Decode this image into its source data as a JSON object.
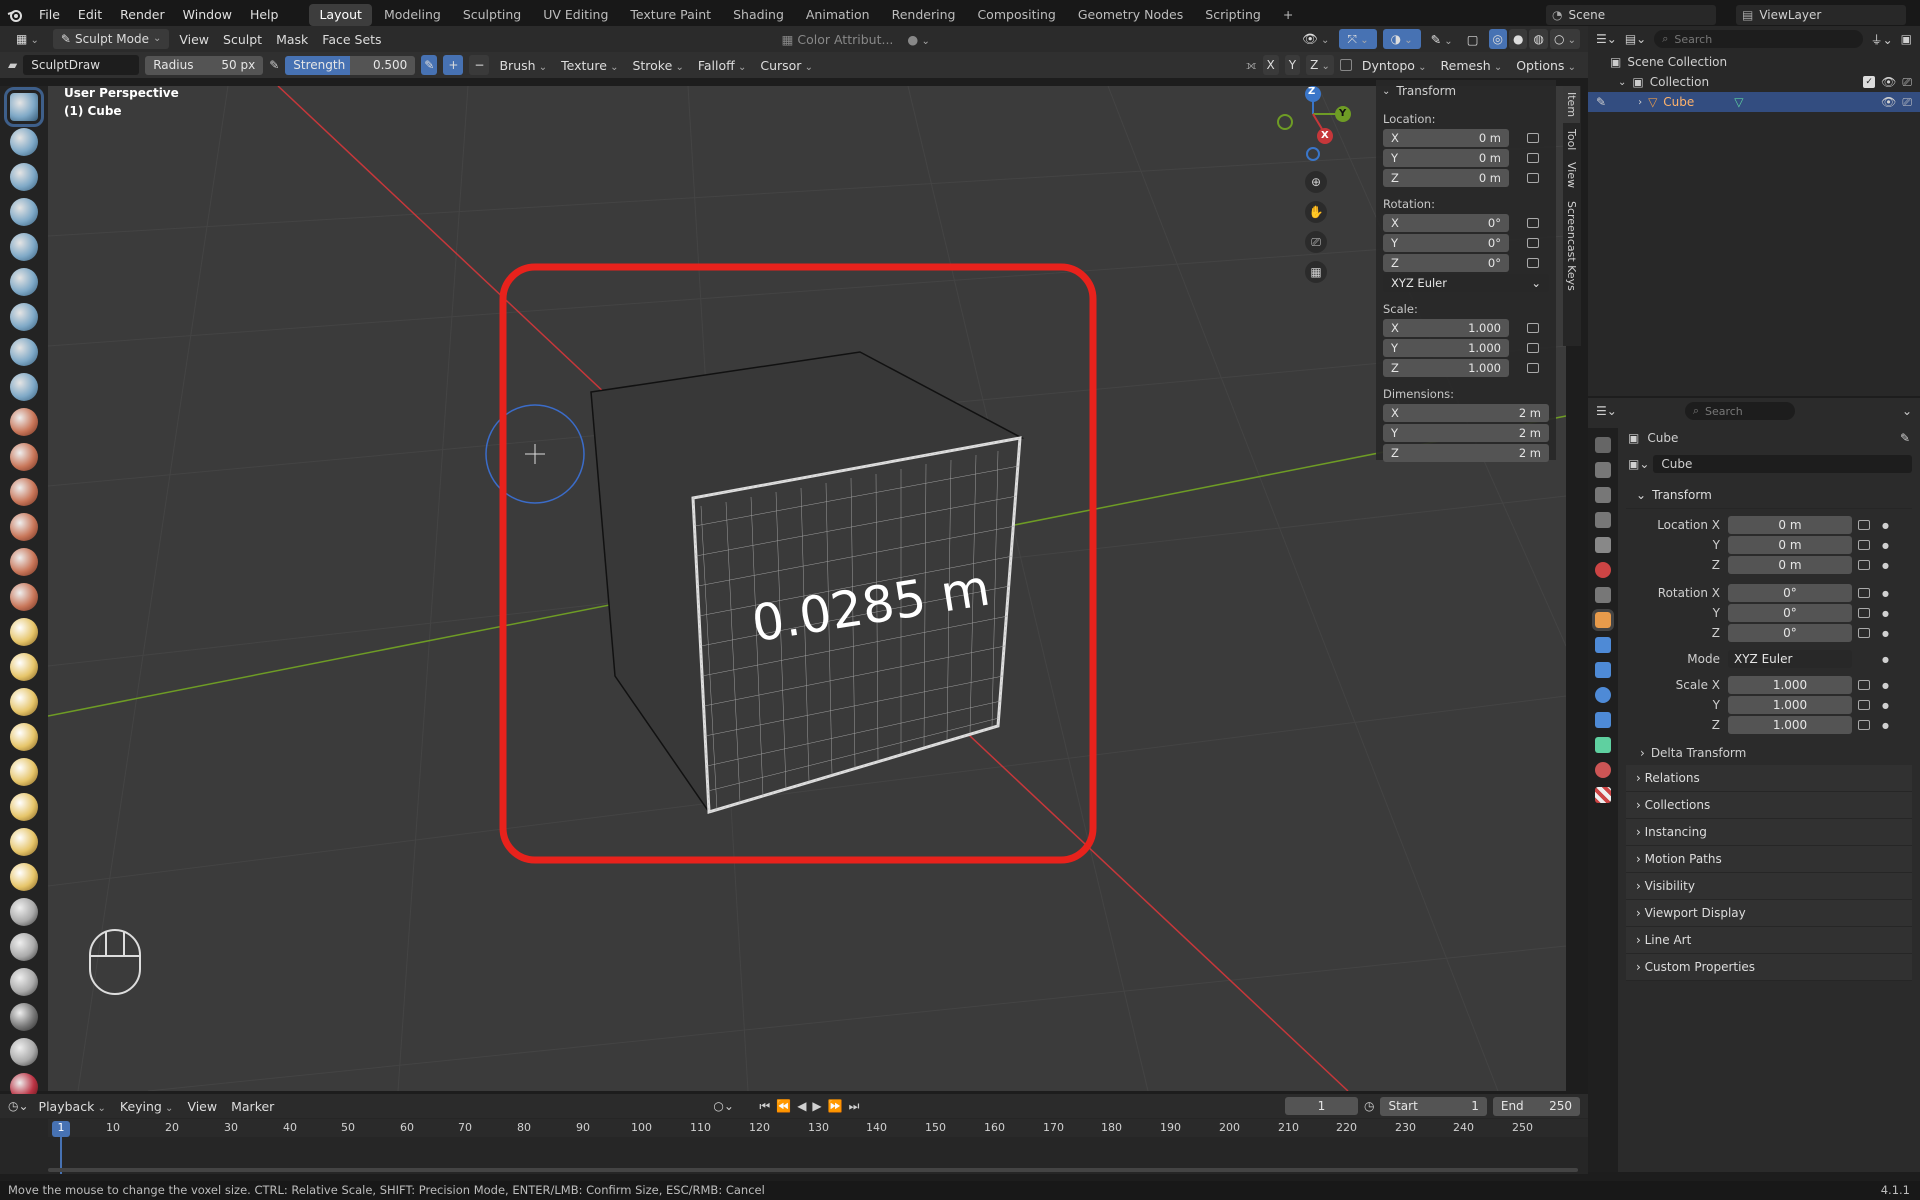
{
  "topbar": {
    "menus": [
      "File",
      "Edit",
      "Render",
      "Window",
      "Help"
    ],
    "workspaces": [
      "Layout",
      "Modeling",
      "Sculpting",
      "UV Editing",
      "Texture Paint",
      "Shading",
      "Animation",
      "Rendering",
      "Compositing",
      "Geometry Nodes",
      "Scripting"
    ],
    "active_workspace": "Layout",
    "scene": "Scene",
    "view_layer": "ViewLayer"
  },
  "viewport_header": {
    "mode": "Sculpt Mode",
    "menus": [
      "View",
      "Sculpt",
      "Mask",
      "Face Sets"
    ],
    "color_attr": "Color Attribut...",
    "axes": [
      "X",
      "Y",
      "Z"
    ]
  },
  "tool_header": {
    "brush_name": "SculptDraw",
    "radius_label": "Radius",
    "radius_value": "50 px",
    "strength_label": "Strength",
    "strength_value": "0.500",
    "plus": "+",
    "minus": "−",
    "menus": [
      "Brush",
      "Texture",
      "Stroke",
      "Falloff",
      "Cursor"
    ],
    "dyntopo": "Dyntopo",
    "remesh": "Remesh",
    "options": "Options"
  },
  "viewport": {
    "view_name": "User Perspective",
    "object_name": "(1) Cube",
    "voxel_size": "0.0285 m",
    "gizmo": {
      "x": "X",
      "y": "Y",
      "z": "Z"
    }
  },
  "n_panel": {
    "title": "Transform",
    "location_label": "Location:",
    "rotation_label": "Rotation:",
    "scale_label": "Scale:",
    "dimensions_label": "Dimensions:",
    "location": [
      {
        "axis": "X",
        "value": "0 m"
      },
      {
        "axis": "Y",
        "value": "0 m"
      },
      {
        "axis": "Z",
        "value": "0 m"
      }
    ],
    "rotation": [
      {
        "axis": "X",
        "value": "0°"
      },
      {
        "axis": "Y",
        "value": "0°"
      },
      {
        "axis": "Z",
        "value": "0°"
      }
    ],
    "rotation_mode": "XYZ Euler",
    "scale": [
      {
        "axis": "X",
        "value": "1.000"
      },
      {
        "axis": "Y",
        "value": "1.000"
      },
      {
        "axis": "Z",
        "value": "1.000"
      }
    ],
    "dimensions": [
      {
        "axis": "X",
        "value": "2 m"
      },
      {
        "axis": "Y",
        "value": "2 m"
      },
      {
        "axis": "Z",
        "value": "2 m"
      }
    ],
    "side_tabs": [
      "Item",
      "Tool",
      "View",
      "Screencast Keys"
    ]
  },
  "outliner": {
    "search_placeholder": "Search",
    "scene_collection": "Scene Collection",
    "collection": "Collection",
    "object": "Cube"
  },
  "properties": {
    "search_placeholder": "Search",
    "object_title": "Cube",
    "object_name_field": "Cube",
    "transform_header": "Transform",
    "rows": [
      {
        "label": "Location X",
        "value": "0 m"
      },
      {
        "label": "Y",
        "value": "0 m"
      },
      {
        "label": "Z",
        "value": "0 m"
      },
      {
        "label": "Rotation X",
        "value": "0°"
      },
      {
        "label": "Y",
        "value": "0°"
      },
      {
        "label": "Z",
        "value": "0°"
      },
      {
        "label": "Mode",
        "value": "XYZ Euler"
      },
      {
        "label": "Scale X",
        "value": "1.000"
      },
      {
        "label": "Y",
        "value": "1.000"
      },
      {
        "label": "Z",
        "value": "1.000"
      }
    ],
    "delta": "Delta Transform",
    "sections": [
      "Relations",
      "Collections",
      "Instancing",
      "Motion Paths",
      "Visibility",
      "Viewport Display",
      "Line Art",
      "Custom Properties"
    ]
  },
  "timeline": {
    "menus": [
      "Playback",
      "Keying",
      "View",
      "Marker"
    ],
    "current_frame": "1",
    "start_label": "Start",
    "start": "1",
    "end_label": "End",
    "end": "250",
    "ticks": [
      "1",
      "10",
      "20",
      "30",
      "40",
      "50",
      "60",
      "70",
      "80",
      "90",
      "100",
      "110",
      "120",
      "130",
      "140",
      "150",
      "160",
      "170",
      "180",
      "190",
      "200",
      "210",
      "220",
      "230",
      "240",
      "250"
    ]
  },
  "status": {
    "message": "Move the mouse to change the voxel size. CTRL: Relative Scale, SHIFT: Precision Mode, ENTER/LMB: Confirm Size, ESC/RMB: Cancel",
    "version": "4.1.1"
  },
  "colors": {
    "accent": "#4772b3",
    "highlight_box": "#e8221c",
    "x_axis": "#c6373a",
    "y_axis": "#6e9c25",
    "z_axis": "#3a76c9"
  }
}
